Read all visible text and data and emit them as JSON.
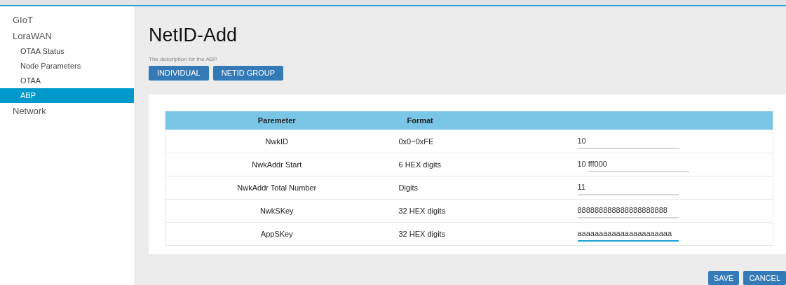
{
  "sidebar": {
    "items": [
      {
        "label": "GIoT",
        "selected": false
      },
      {
        "label": "LoraWAN",
        "selected": false,
        "children": [
          {
            "label": "OTAA Status",
            "selected": false
          },
          {
            "label": "Node Parameters",
            "selected": false
          },
          {
            "label": "OTAA",
            "selected": false
          },
          {
            "label": "ABP",
            "selected": true
          }
        ]
      },
      {
        "label": "Network",
        "selected": false
      }
    ]
  },
  "page": {
    "title": "NetID-Add",
    "description": "The description for the ABP.",
    "tab_buttons": [
      "INDIVIDUAL",
      "NETID GROUP"
    ]
  },
  "table": {
    "columns": [
      "Paremeter",
      "Format"
    ],
    "rows": [
      {
        "parameter": "NwkID",
        "format": "0x0~0xFE",
        "value": "10",
        "focused": false
      },
      {
        "parameter": "NwkAddr Start",
        "format": "6 HEX digits",
        "prefix": "10",
        "value": "fff000",
        "focused": false
      },
      {
        "parameter": "NwkAddr Total Number",
        "format": "Digits",
        "value": "11",
        "focused": false
      },
      {
        "parameter": "NwkSKey",
        "format": "32 HEX digits",
        "value": "888888888888888888888",
        "focused": false
      },
      {
        "parameter": "AppSKey",
        "format": "32 HEX digits",
        "value": "aaaaaaaaaaaaaaaaaaaaaa",
        "focused": true
      }
    ]
  },
  "buttons": [
    "SAVE",
    "CANCEL"
  ]
}
